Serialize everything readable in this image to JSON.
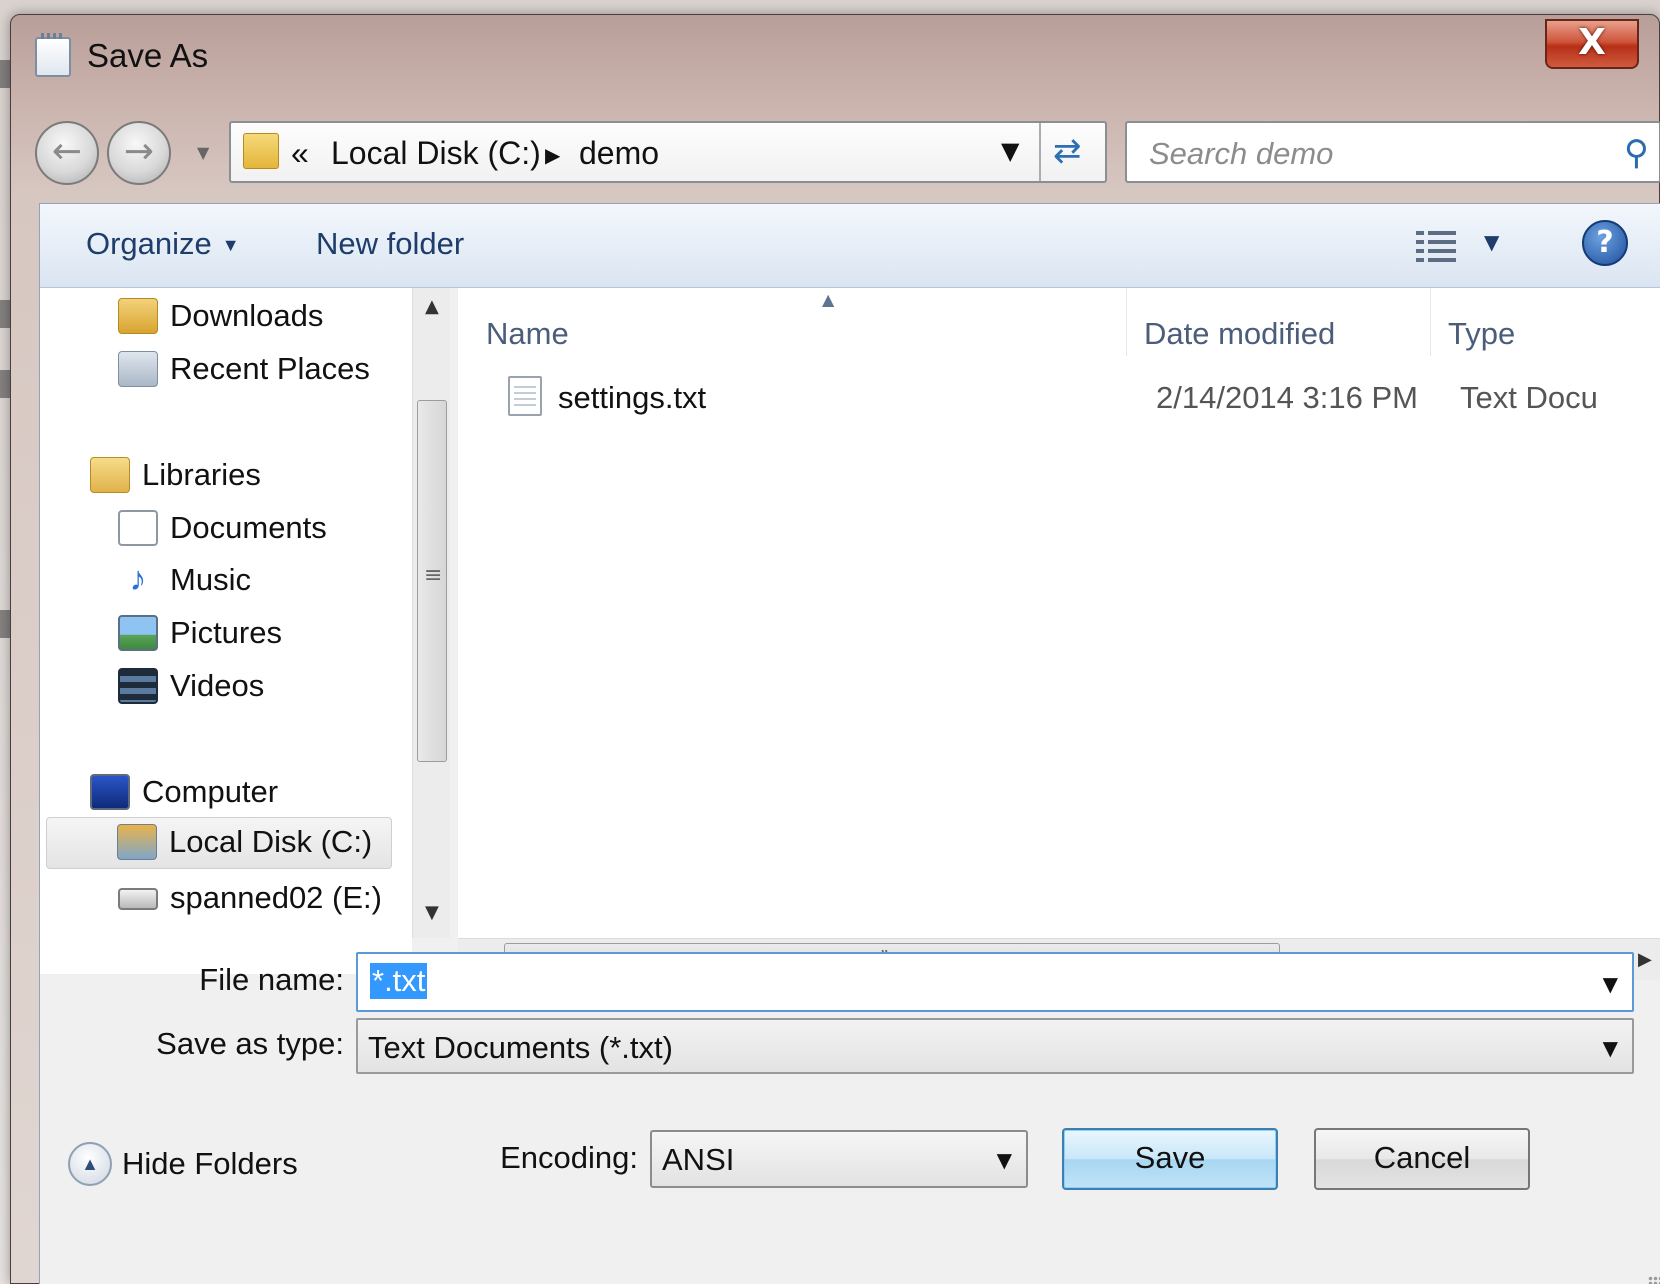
{
  "window": {
    "title": "Save As",
    "close_glyph": "X"
  },
  "address": {
    "overflow": "«",
    "segments": [
      "Local Disk (C:)",
      "demo"
    ]
  },
  "search": {
    "placeholder": "Search demo"
  },
  "toolbar": {
    "organize_label": "Organize",
    "new_folder_label": "New folder"
  },
  "navigation": {
    "items": [
      {
        "label": "Downloads",
        "icon": "downloads-folder-icon"
      },
      {
        "label": "Recent Places",
        "icon": "recent-places-icon"
      },
      {
        "label": "Libraries",
        "icon": "libraries-icon"
      },
      {
        "label": "Documents",
        "icon": "documents-icon"
      },
      {
        "label": "Music",
        "icon": "music-icon"
      },
      {
        "label": "Pictures",
        "icon": "pictures-icon"
      },
      {
        "label": "Videos",
        "icon": "videos-icon"
      },
      {
        "label": "Computer",
        "icon": "computer-icon"
      },
      {
        "label": "Local Disk (C:)",
        "icon": "local-disk-icon",
        "selected": true
      },
      {
        "label": "spanned02 (E:)",
        "icon": "drive-icon"
      }
    ]
  },
  "file_list": {
    "columns": [
      "Name",
      "Date modified",
      "Type"
    ],
    "rows": [
      {
        "name": "settings.txt",
        "date_modified": "2/14/2014 3:16 PM",
        "type": "Text Docu"
      }
    ]
  },
  "form": {
    "file_name_label": "File name:",
    "file_name_value": "*.txt",
    "save_as_type_label": "Save as type:",
    "save_as_type_value": "Text Documents (*.txt)",
    "encoding_label": "Encoding:",
    "encoding_value": "ANSI",
    "hide_folders_label": "Hide Folders",
    "save_label": "Save",
    "cancel_label": "Cancel"
  },
  "colors": {
    "accent": "#3399ff",
    "toolbar_text": "#1e3d6b",
    "close_button": "#c8452c"
  }
}
